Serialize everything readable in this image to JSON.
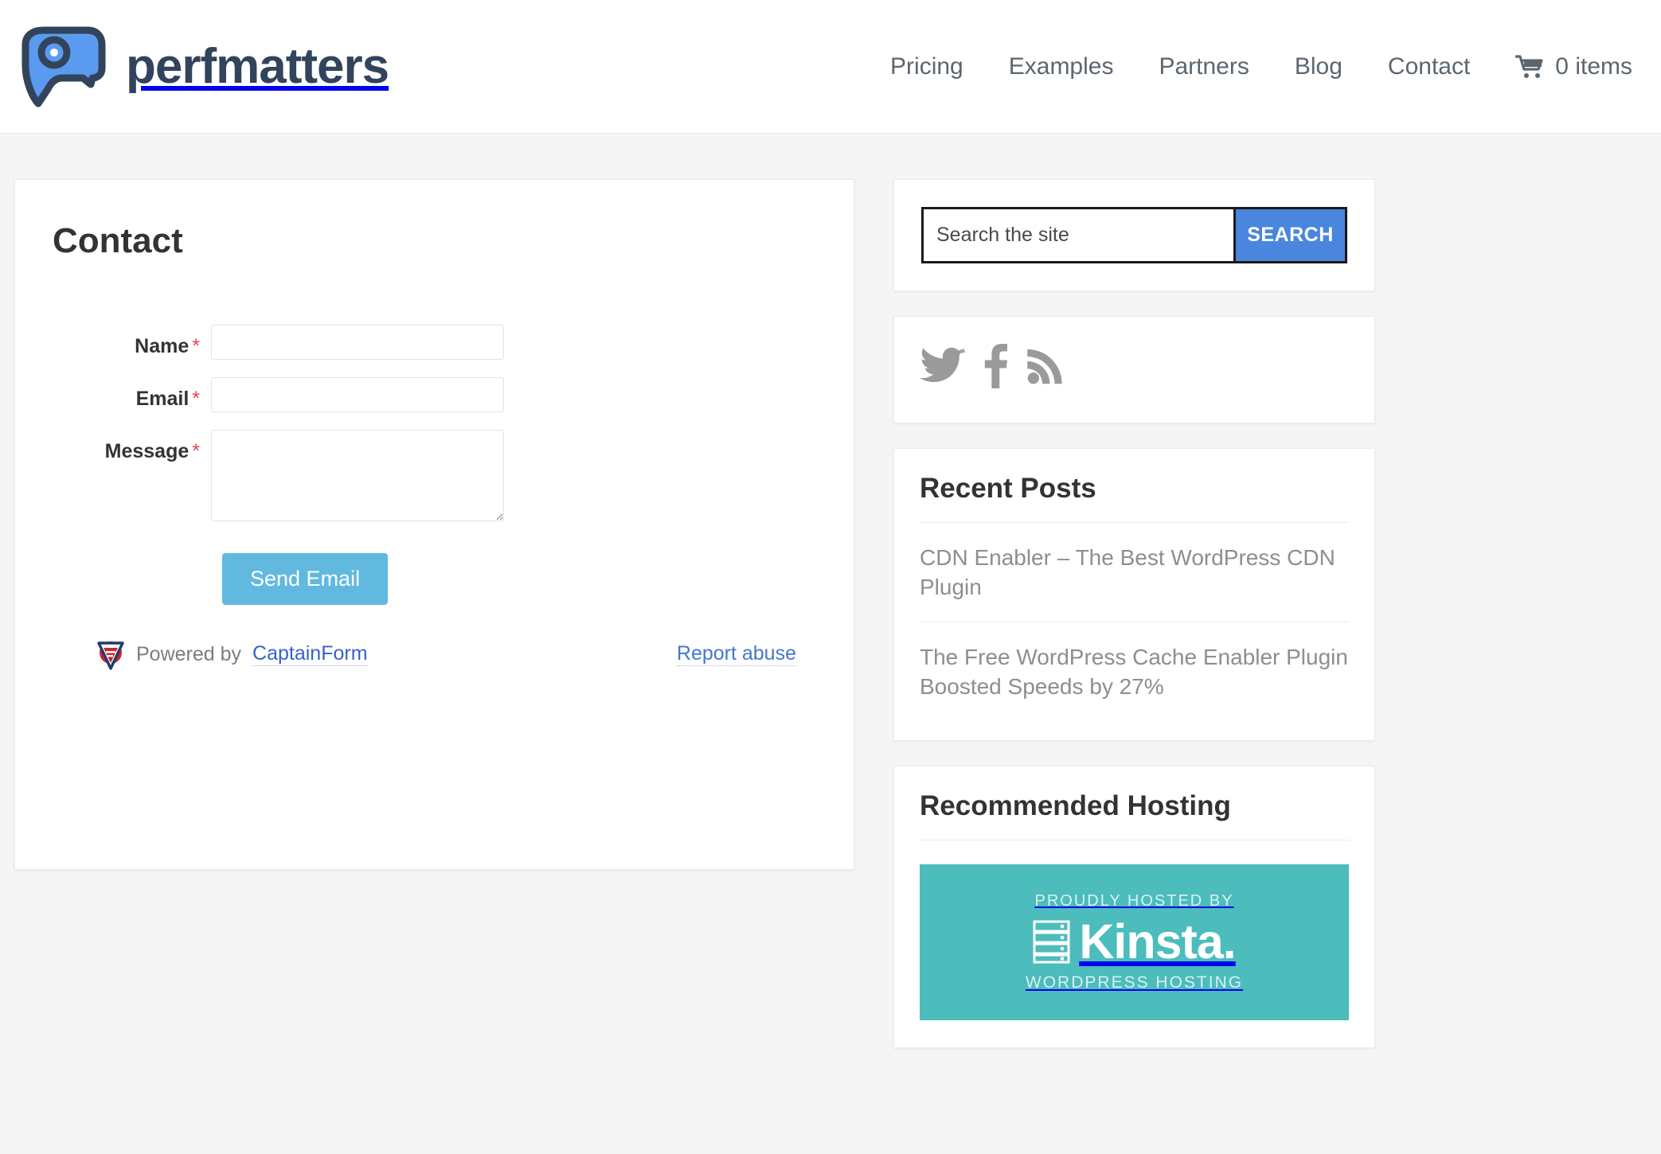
{
  "header": {
    "brand_name": "perfmatters",
    "logo_icon": "perfmatters-speech-pin-logo",
    "nav": [
      {
        "label": "Pricing",
        "name": "nav-link-pricing"
      },
      {
        "label": "Examples",
        "name": "nav-link-examples"
      },
      {
        "label": "Partners",
        "name": "nav-link-partners"
      },
      {
        "label": "Blog",
        "name": "nav-link-blog"
      },
      {
        "label": "Contact",
        "name": "nav-link-contact"
      }
    ],
    "cart": {
      "icon": "shopping-cart-icon",
      "label": "0 items"
    }
  },
  "main": {
    "title": "Contact",
    "form": {
      "fields": [
        {
          "label": "Name",
          "required_mark": "*",
          "value": "",
          "placeholder": "",
          "type": "text",
          "name": "name"
        },
        {
          "label": "Email",
          "required_mark": "*",
          "value": "",
          "placeholder": "",
          "type": "text",
          "name": "email"
        },
        {
          "label": "Message",
          "required_mark": "*",
          "value": "",
          "placeholder": "",
          "type": "textarea",
          "name": "message"
        }
      ],
      "submit_label": "Send Email"
    },
    "footer": {
      "powered_prefix": "Powered by",
      "powered_brand": "CaptainForm",
      "powered_icon": "captainform-shield-logo",
      "report_label": "Report abuse"
    }
  },
  "sidebar": {
    "search": {
      "placeholder": "Search the site",
      "value": "",
      "button_label": "SEARCH"
    },
    "social": [
      {
        "name": "twitter-icon",
        "label": "Twitter"
      },
      {
        "name": "facebook-icon",
        "label": "Facebook"
      },
      {
        "name": "rss-icon",
        "label": "RSS Feed"
      }
    ],
    "recent_posts": {
      "title": "Recent Posts",
      "items": [
        {
          "title": "CDN Enabler – The Best WordPress CDN Plugin"
        },
        {
          "title": "The Free WordPress Cache Enabler Plugin Boosted Speeds by 27%"
        }
      ]
    },
    "hosting": {
      "title": "Recommended Hosting",
      "banner": {
        "top_text": "PROUDLY HOSTED BY",
        "brand": "Kinsta.",
        "bottom_text": "WORDPRESS HOSTING",
        "icon": "kinsta-server-rack-icon"
      }
    }
  },
  "colors": {
    "page_bg": "#f5f5f5",
    "brand_navy": "#31445c",
    "brand_blue": "#4a86dd",
    "submit_blue": "#61b9e0",
    "kinsta_teal": "#4cbcbc",
    "required_red": "#e8434f",
    "link_blue": "#4477cc"
  }
}
